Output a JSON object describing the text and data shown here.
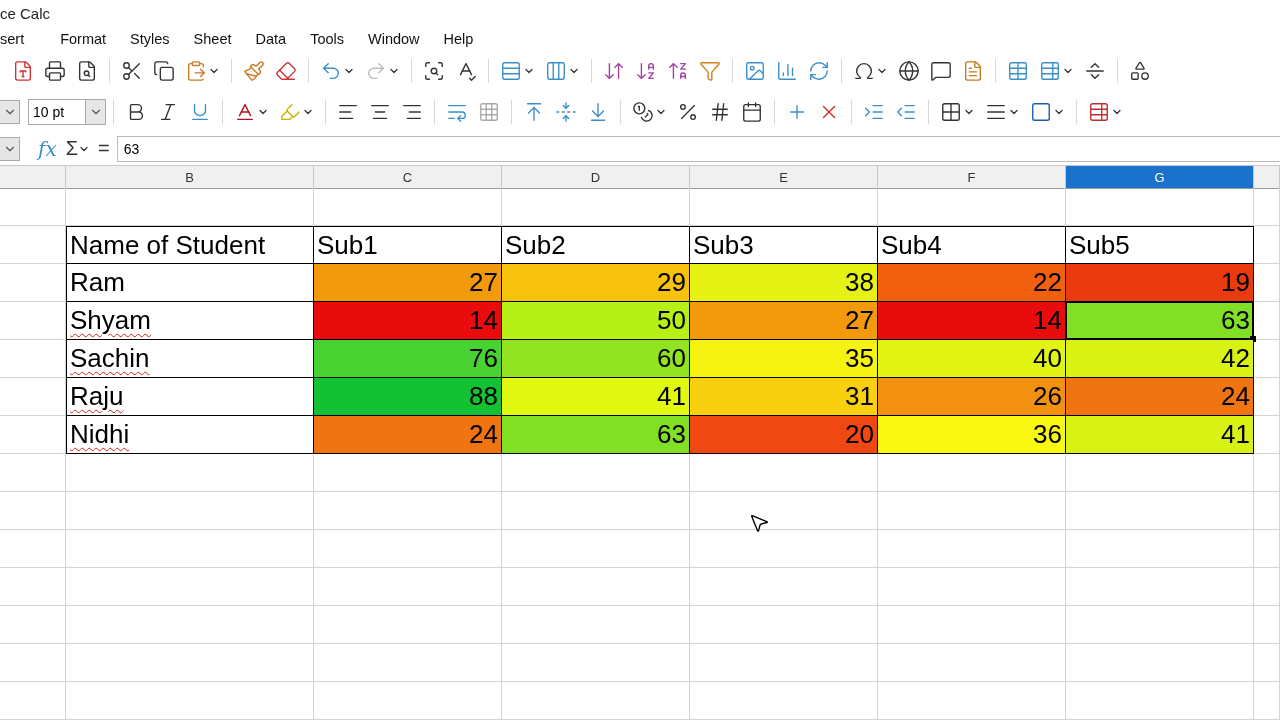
{
  "window": {
    "title": "ce Calc"
  },
  "menu": [
    "sert",
    "Format",
    "Styles",
    "Sheet",
    "Data",
    "Tools",
    "Window",
    "Help"
  ],
  "font_size": {
    "value": "10 pt"
  },
  "formula_bar": {
    "function_wizard": "fx",
    "sum": "Σ",
    "equals": "=",
    "value": "63"
  },
  "column_headers": [
    {
      "label": "B",
      "selected": false
    },
    {
      "label": "C",
      "selected": false
    },
    {
      "label": "D",
      "selected": false
    },
    {
      "label": "E",
      "selected": false
    },
    {
      "label": "F",
      "selected": false
    },
    {
      "label": "G",
      "selected": true
    }
  ],
  "table": {
    "columns": [
      "Name of Student",
      "Sub1",
      "Sub2",
      "Sub3",
      "Sub4",
      "Sub5"
    ],
    "rows": [
      {
        "name": "Ram",
        "misspelled": false,
        "cells": [
          {
            "value": "27",
            "color": "#f29a0c",
            "selected": false
          },
          {
            "value": "29",
            "color": "#f6c20e",
            "selected": false
          },
          {
            "value": "38",
            "color": "#e6f214",
            "selected": false
          },
          {
            "value": "22",
            "color": "#f0600e",
            "selected": false
          },
          {
            "value": "19",
            "color": "#ea3a10",
            "selected": false
          }
        ]
      },
      {
        "name": "Shyam",
        "misspelled": true,
        "cells": [
          {
            "value": "14",
            "color": "#e80c0c",
            "selected": false
          },
          {
            "value": "50",
            "color": "#b6f016",
            "selected": false
          },
          {
            "value": "27",
            "color": "#f29a0c",
            "selected": false
          },
          {
            "value": "14",
            "color": "#e80c0c",
            "selected": false
          },
          {
            "value": "63",
            "color": "#82e024",
            "selected": true
          }
        ]
      },
      {
        "name": "Sachin",
        "misspelled": true,
        "cells": [
          {
            "value": "76",
            "color": "#48d232",
            "selected": false
          },
          {
            "value": "60",
            "color": "#92e420",
            "selected": false
          },
          {
            "value": "35",
            "color": "#f6f212",
            "selected": false
          },
          {
            "value": "40",
            "color": "#e2f414",
            "selected": false
          },
          {
            "value": "42",
            "color": "#d8f214",
            "selected": false
          }
        ]
      },
      {
        "name": "Raju",
        "misspelled": true,
        "cells": [
          {
            "value": "88",
            "color": "#12c232",
            "selected": false
          },
          {
            "value": "41",
            "color": "#e0f812",
            "selected": false
          },
          {
            "value": "31",
            "color": "#f8d010",
            "selected": false
          },
          {
            "value": "26",
            "color": "#f29010",
            "selected": false
          },
          {
            "value": "24",
            "color": "#f07412",
            "selected": false
          }
        ]
      },
      {
        "name": "Nidhi",
        "misspelled": true,
        "cells": [
          {
            "value": "24",
            "color": "#f07412",
            "selected": false
          },
          {
            "value": "63",
            "color": "#82e024",
            "selected": false
          },
          {
            "value": "20",
            "color": "#f04812",
            "selected": false
          },
          {
            "value": "36",
            "color": "#f8f812",
            "selected": false
          },
          {
            "value": "41",
            "color": "#d8f214",
            "selected": false
          }
        ]
      }
    ]
  }
}
